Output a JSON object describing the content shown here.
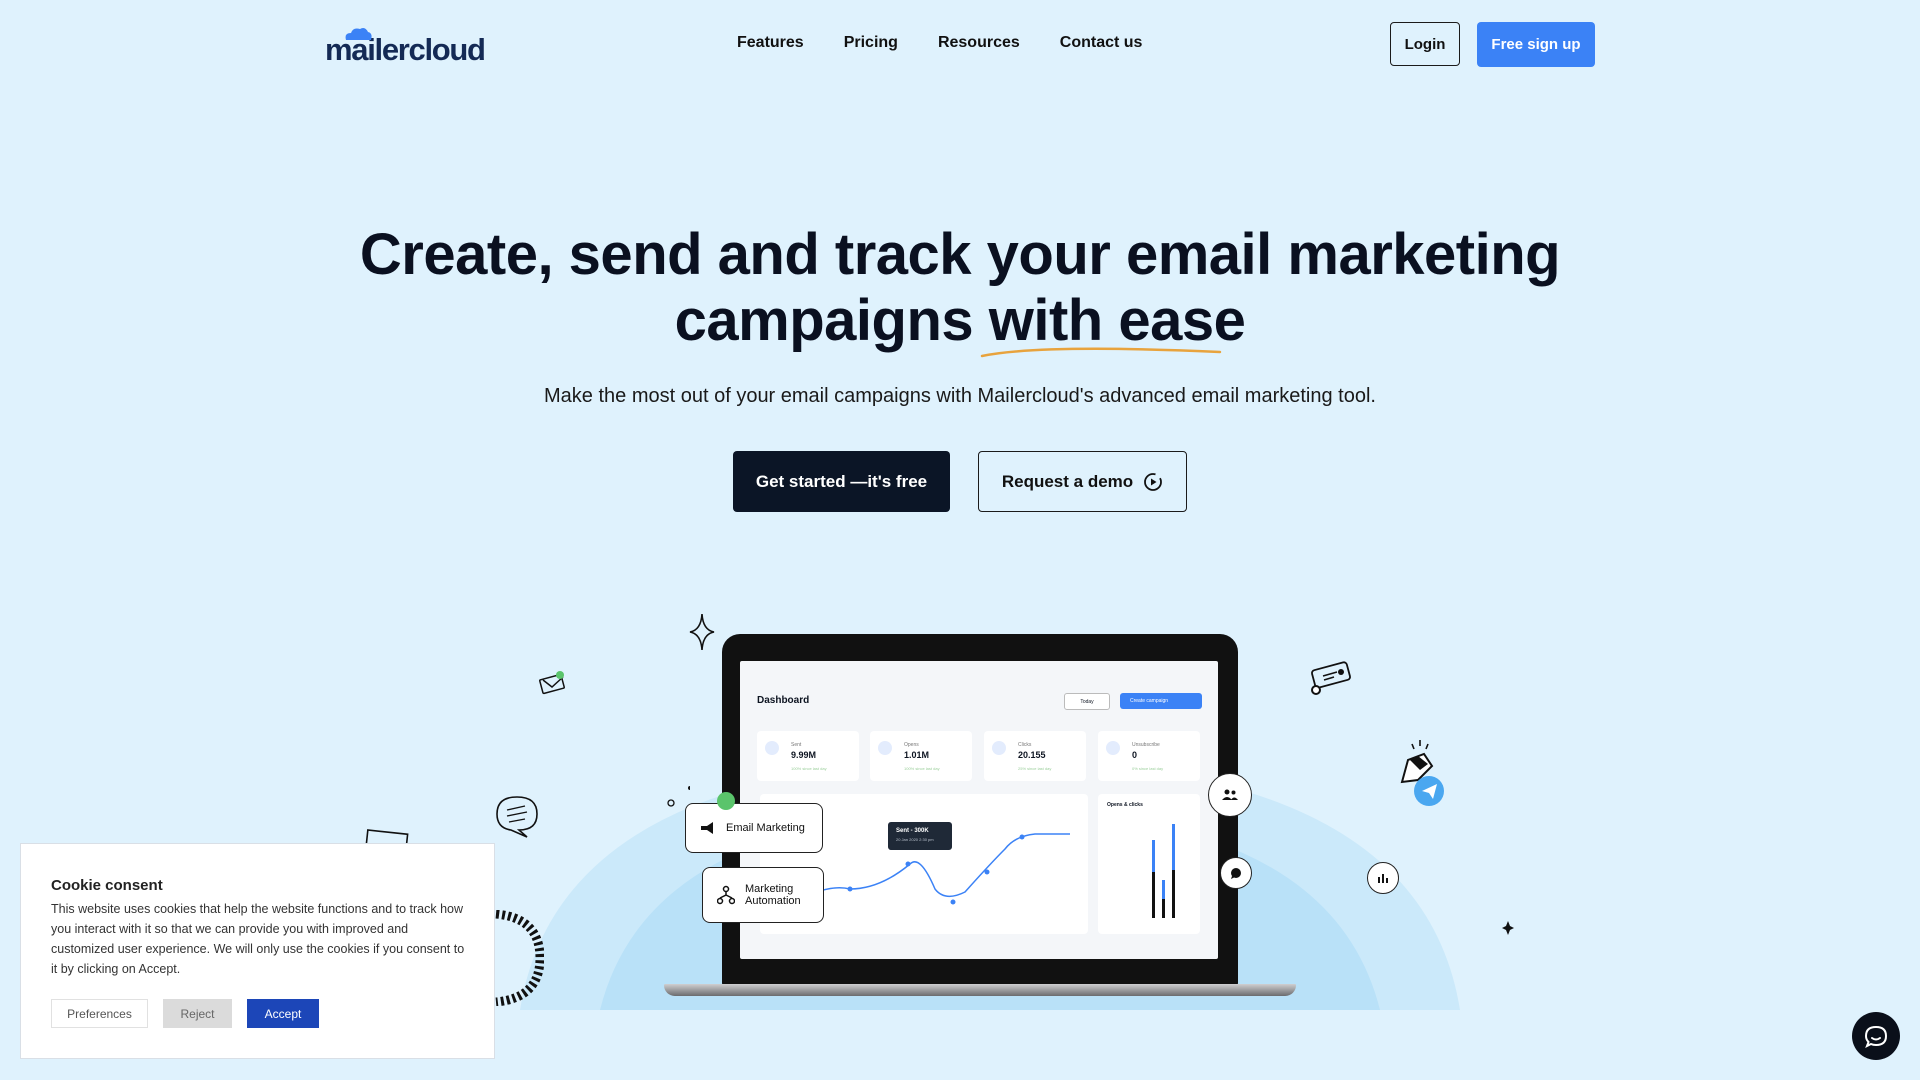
{
  "brand": {
    "name": "mailercloud",
    "primary_color": "#3b82f6",
    "dark_color": "#0b1526",
    "background": "#dff2fd"
  },
  "nav": {
    "items": [
      "Features",
      "Pricing",
      "Resources",
      "Contact us"
    ]
  },
  "header": {
    "login_label": "Login",
    "signup_label": "Free sign up"
  },
  "hero": {
    "title_line1": "Create, send and track your email marketing",
    "title_line2_a": "campaigns",
    "title_line2_b": "with ease",
    "subtitle": "Make the most out of your email campaigns with Mailercloud's advanced email marketing tool.",
    "cta_primary": "Get started —it's free",
    "cta_secondary": "Request a demo"
  },
  "dashboard": {
    "title": "Dashboard",
    "today_label": "Today",
    "create_label": "Create campaign",
    "stats": [
      {
        "label": "Sent",
        "value": "9.99M",
        "change": "100% since last day"
      },
      {
        "label": "Opens",
        "value": "1.01M",
        "change": "100% since last day"
      },
      {
        "label": "Clicks",
        "value": "20.155",
        "change": "25% since last day"
      },
      {
        "label": "Unsubscribe",
        "value": "0",
        "change": "0% since last day"
      }
    ],
    "tooltip_title": "Sent - 300K",
    "tooltip_date": "20 Jan 2020 2:30 pm",
    "bar_card_title": "Opens & clicks"
  },
  "floating": {
    "email_marketing": "Email Marketing",
    "automation_line1": "Marketing",
    "automation_line2": "Automation"
  },
  "cookie": {
    "title": "Cookie consent",
    "text": "This website uses cookies that help the website functions and to track how you interact with it so that we can provide you with improved and customized user experience. We will only use the cookies if you consent to it by clicking on Accept.",
    "preferences": "Preferences",
    "reject": "Reject",
    "accept": "Accept"
  }
}
